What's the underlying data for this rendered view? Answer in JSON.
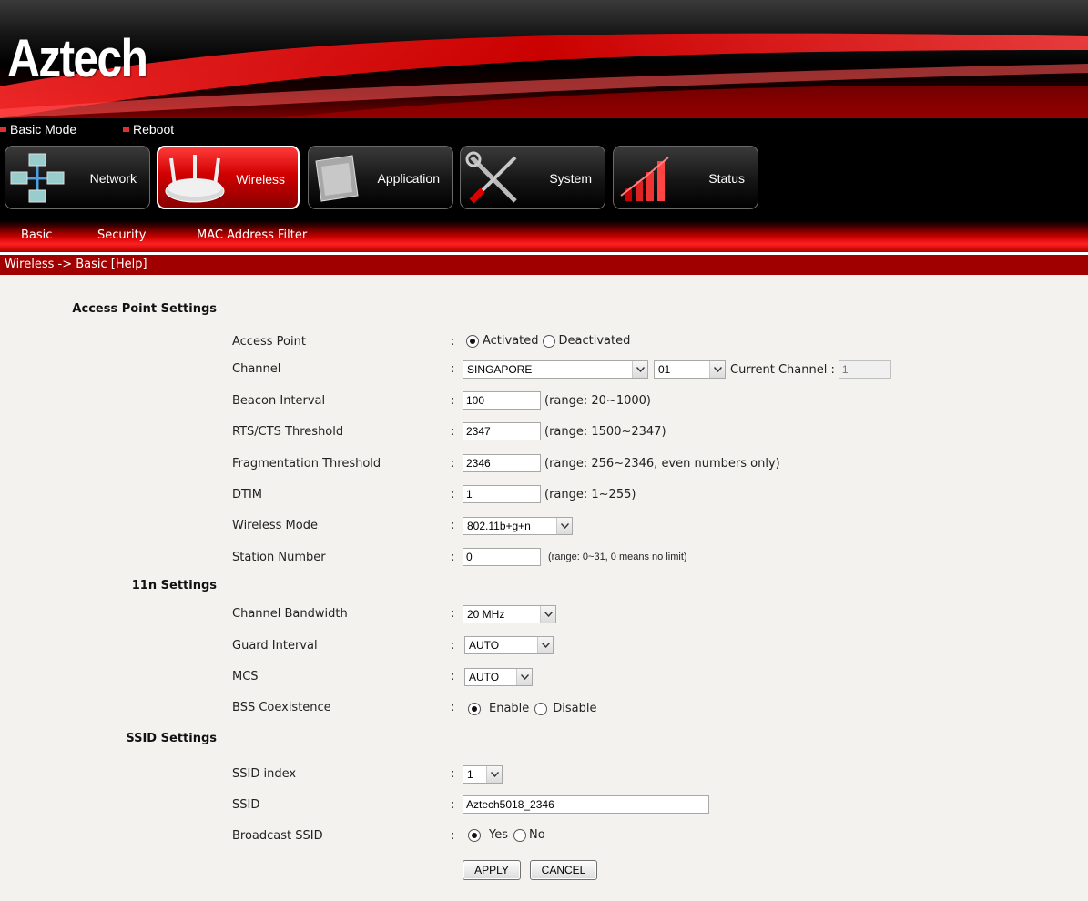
{
  "brand": {
    "logo_text": "Aztech"
  },
  "mode_bar": {
    "basic_mode": "Basic Mode",
    "reboot": "Reboot"
  },
  "nav_tabs": [
    {
      "label": "Network",
      "icon": "network-icon",
      "active": false
    },
    {
      "label": "Wireless",
      "icon": "wireless-router-icon",
      "active": true
    },
    {
      "label": "Application",
      "icon": "application-icon",
      "active": false
    },
    {
      "label": "System",
      "icon": "tools-icon",
      "active": false
    },
    {
      "label": "Status",
      "icon": "status-chart-icon",
      "active": false
    }
  ],
  "sub_nav": [
    "Basic",
    "Security",
    "MAC Address Filter"
  ],
  "breadcrumb": {
    "path": "Wireless -> Basic ",
    "help": "[Help]"
  },
  "sections": {
    "access_point": "Access Point Settings",
    "n11": "11n Settings",
    "ssid": "SSID Settings"
  },
  "colon": ":",
  "fields": {
    "access_point": {
      "label": "Access Point",
      "options": [
        "Activated",
        "Deactivated"
      ],
      "selected": "Activated"
    },
    "channel": {
      "label": "Channel",
      "country": "SINGAPORE",
      "channel": "01",
      "current_label": "Current Channel :",
      "current_value": "1"
    },
    "beacon_interval": {
      "label": "Beacon Interval",
      "value": "100",
      "hint": "(range: 20~1000)"
    },
    "rts_threshold": {
      "label": "RTS/CTS Threshold",
      "value": "2347",
      "hint": "(range: 1500~2347)"
    },
    "frag_threshold": {
      "label": "Fragmentation Threshold",
      "value": "2346",
      "hint": "(range: 256~2346, even numbers only)"
    },
    "dtim": {
      "label": "DTIM",
      "value": "1",
      "hint": "(range: 1~255)"
    },
    "wireless_mode": {
      "label": "Wireless Mode",
      "value": "802.11b+g+n"
    },
    "station_number": {
      "label": "Station Number",
      "value": "0",
      "hint": "(range: 0~31, 0 means no limit)"
    },
    "channel_bandwidth": {
      "label": "Channel Bandwidth",
      "value": "20 MHz"
    },
    "guard_interval": {
      "label": "Guard Interval",
      "value": "AUTO"
    },
    "mcs": {
      "label": "MCS",
      "value": "AUTO"
    },
    "bss_coexistence": {
      "label": "BSS Coexistence",
      "options": [
        "Enable",
        "Disable"
      ],
      "selected": "Enable"
    },
    "ssid_index": {
      "label": "SSID index",
      "value": "1"
    },
    "ssid": {
      "label": "SSID",
      "value": "Aztech5018_2346"
    },
    "broadcast_ssid": {
      "label": "Broadcast SSID",
      "options": [
        "Yes",
        "No"
      ],
      "selected": "Yes"
    }
  },
  "buttons": {
    "apply": "APPLY",
    "cancel": "CANCEL"
  },
  "colors": {
    "brand_red": "#d00000",
    "breadcrumb_red": "#a00000",
    "content_bg": "#f3f2ef"
  }
}
